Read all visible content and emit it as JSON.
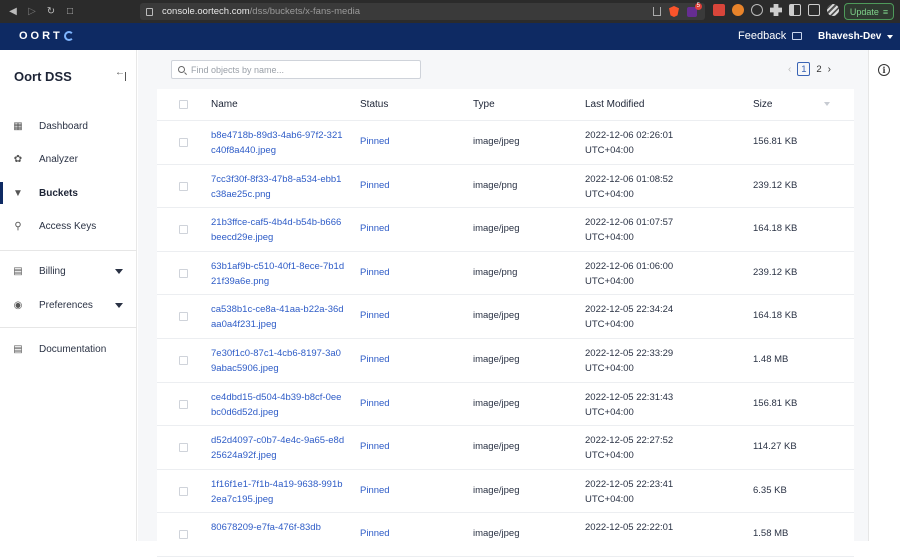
{
  "browser": {
    "url_host": "console.oortech.com",
    "url_path": "/dss/buckets/x-fans-media",
    "update_label": "Update",
    "ext_badge": "5"
  },
  "header": {
    "logo": "OORT",
    "feedback": "Feedback",
    "user": "Bhavesh-Dev"
  },
  "sidebar": {
    "title": "Oort DSS",
    "items": [
      {
        "label": "Dashboard",
        "icon": "dashboard-icon"
      },
      {
        "label": "Analyzer",
        "icon": "analyzer-icon"
      },
      {
        "label": "Buckets",
        "icon": "bucket-icon"
      },
      {
        "label": "Access Keys",
        "icon": "key-icon"
      },
      {
        "label": "Billing",
        "icon": "billing-icon"
      },
      {
        "label": "Preferences",
        "icon": "preferences-icon"
      },
      {
        "label": "Documentation",
        "icon": "documentation-icon"
      }
    ]
  },
  "search": {
    "placeholder": "Find objects by name..."
  },
  "pager": {
    "current": "1",
    "next": "2"
  },
  "table": {
    "headers": {
      "name": "Name",
      "status": "Status",
      "type": "Type",
      "modified": "Last Modified",
      "size": "Size"
    },
    "rows": [
      {
        "name": "b8e4718b-89d3-4ab6-97f2-321c40f8a440.jpeg",
        "status": "Pinned",
        "type": "image/jpeg",
        "date": "2022-12-06 02:26:01",
        "tz": "UTC+04:00",
        "size": "156.81 KB"
      },
      {
        "name": "7cc3f30f-8f33-47b8-a534-ebb1c38ae25c.png",
        "status": "Pinned",
        "type": "image/png",
        "date": "2022-12-06 01:08:52",
        "tz": "UTC+04:00",
        "size": "239.12 KB"
      },
      {
        "name": "21b3ffce-caf5-4b4d-b54b-b666beecd29e.jpeg",
        "status": "Pinned",
        "type": "image/jpeg",
        "date": "2022-12-06 01:07:57",
        "tz": "UTC+04:00",
        "size": "164.18 KB"
      },
      {
        "name": "63b1af9b-c510-40f1-8ece-7b1d21f39a6e.png",
        "status": "Pinned",
        "type": "image/png",
        "date": "2022-12-06 01:06:00",
        "tz": "UTC+04:00",
        "size": "239.12 KB"
      },
      {
        "name": "ca538b1c-ce8a-41aa-b22a-36daa0a4f231.jpeg",
        "status": "Pinned",
        "type": "image/jpeg",
        "date": "2022-12-05 22:34:24",
        "tz": "UTC+04:00",
        "size": "164.18 KB"
      },
      {
        "name": "7e30f1c0-87c1-4cb6-8197-3a09abac5906.jpeg",
        "status": "Pinned",
        "type": "image/jpeg",
        "date": "2022-12-05 22:33:29",
        "tz": "UTC+04:00",
        "size": "1.48 MB"
      },
      {
        "name": "ce4dbd15-d504-4b39-b8cf-0eebc0d6d52d.jpeg",
        "status": "Pinned",
        "type": "image/jpeg",
        "date": "2022-12-05 22:31:43",
        "tz": "UTC+04:00",
        "size": "156.81 KB"
      },
      {
        "name": "d52d4097-c0b7-4e4c-9a65-e8d25624a92f.jpeg",
        "status": "Pinned",
        "type": "image/jpeg",
        "date": "2022-12-05 22:27:52",
        "tz": "UTC+04:00",
        "size": "114.27 KB"
      },
      {
        "name": "1f16f1e1-7f1b-4a19-9638-991b2ea7c195.jpeg",
        "status": "Pinned",
        "type": "image/jpeg",
        "date": "2022-12-05 22:23:41",
        "tz": "UTC+04:00",
        "size": "6.35 KB"
      },
      {
        "name": "80678209-e7fa-476f-83db",
        "status": "Pinned",
        "type": "image/jpeg",
        "date": "2022-12-05 22:22:01",
        "tz": "",
        "size": "1.58 MB"
      }
    ]
  }
}
